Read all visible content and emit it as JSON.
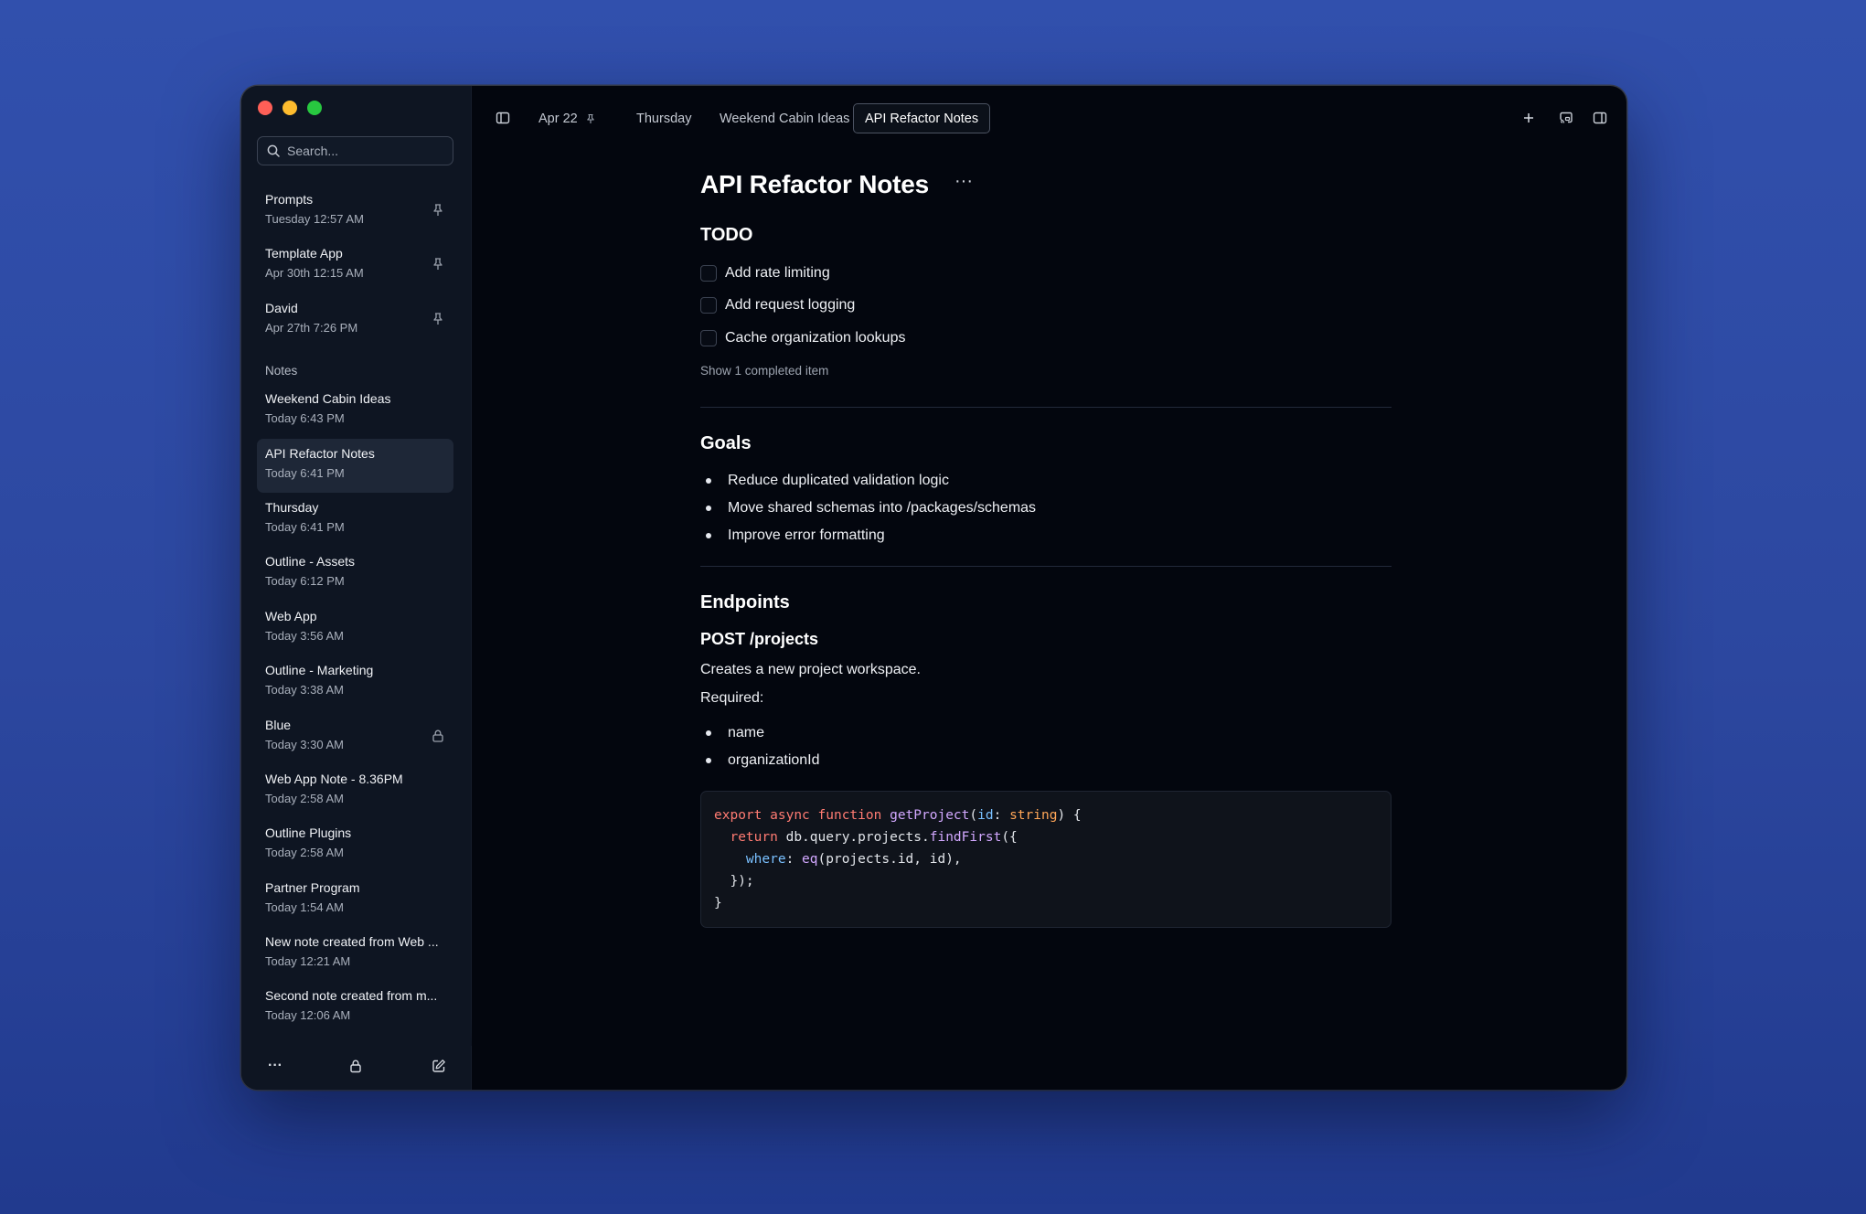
{
  "window": {
    "search": {
      "placeholder": "Search..."
    }
  },
  "sidebar": {
    "pinned": [
      {
        "title": "Prompts",
        "date": "Tuesday 12:57 AM",
        "badge": "pin-icon"
      },
      {
        "title": "Template App",
        "date": "Apr 30th 12:15 AM",
        "badge": "pin-icon"
      },
      {
        "title": "David",
        "date": "Apr 27th 7:26 PM",
        "badge": "pin-icon"
      }
    ],
    "section_label": "Notes",
    "notes": [
      {
        "title": "Weekend Cabin Ideas",
        "date": "Today 6:43 PM"
      },
      {
        "title": "API Refactor Notes",
        "date": "Today 6:41 PM",
        "active": true
      },
      {
        "title": "Thursday",
        "date": "Today 6:41 PM"
      },
      {
        "title": "Outline - Assets",
        "date": "Today 6:12 PM"
      },
      {
        "title": "Web App",
        "date": "Today 3:56 AM"
      },
      {
        "title": "Outline - Marketing",
        "date": "Today 3:38 AM"
      },
      {
        "title": "Blue",
        "date": "Today 3:30 AM",
        "badge": "lock-icon"
      },
      {
        "title": "Web App Note - 8.36PM",
        "date": "Today 2:58 AM"
      },
      {
        "title": "Outline Plugins",
        "date": "Today 2:58 AM"
      },
      {
        "title": "Partner Program",
        "date": "Today 1:54 AM"
      },
      {
        "title": "New note created from Web ...",
        "date": "Today 12:21 AM"
      },
      {
        "title": "Second note created from m...",
        "date": "Today 12:06 AM"
      }
    ],
    "footer": {
      "more_label": "···"
    }
  },
  "tabs": [
    {
      "label": "Apr 22",
      "pinned": true
    },
    {
      "label": "Thursday"
    },
    {
      "label": "Weekend Cabin Ideas"
    },
    {
      "label": "API Refactor Notes",
      "active": true
    }
  ],
  "doc": {
    "title": "API Refactor Notes",
    "more_label": "···",
    "todo_heading": "TODO",
    "todos": [
      "Add rate limiting",
      "Add request logging",
      "Cache organization lookups"
    ],
    "show_completed": "Show 1 completed item",
    "goals_heading": "Goals",
    "goals": [
      "Reduce duplicated validation logic",
      "Move shared schemas into /packages/schemas",
      "Improve error formatting"
    ],
    "endpoints_heading": "Endpoints",
    "post_heading": "POST /projects",
    "post_desc": "Creates a new project workspace.",
    "required_label": "Required:",
    "required_fields": [
      "name",
      "organizationId"
    ],
    "code": {
      "language": "typescript",
      "lines": [
        "export async function getProject(id: string) {",
        "  return db.query.projects.findFirst({",
        "    where: eq(projects.id, id),",
        "  });",
        "}"
      ]
    }
  },
  "colors": {
    "background": "#3150ad",
    "window": "#03060e",
    "sidebar": "#0e1522",
    "active_item": "#1e2737",
    "traffic_red": "#fe5f57",
    "traffic_yellow": "#febc2e",
    "traffic_green": "#28c840"
  }
}
